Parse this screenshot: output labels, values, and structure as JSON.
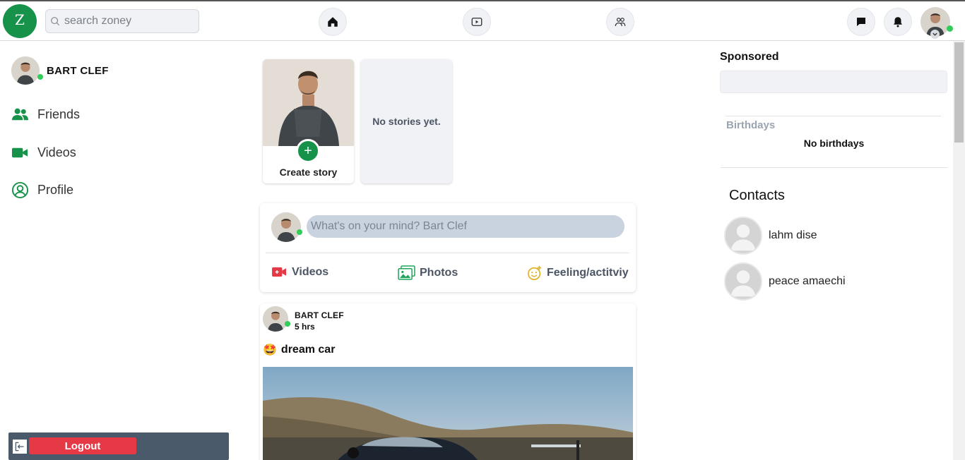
{
  "header": {
    "logo_letter": "Z",
    "search_placeholder": "search zoney",
    "nav": [
      "home-icon",
      "video-icon",
      "groups-icon"
    ],
    "actions": [
      "messenger-icon",
      "bell-icon"
    ]
  },
  "sidebar": {
    "user_name": "BART CLEF",
    "items": [
      {
        "label": "Friends",
        "icon": "friends-icon"
      },
      {
        "label": "Videos",
        "icon": "video-camera-icon"
      },
      {
        "label": "Profile",
        "icon": "profile-icon"
      }
    ],
    "logout_label": "Logout"
  },
  "stories": {
    "create_label": "Create story",
    "empty_label": "No stories yet."
  },
  "composer": {
    "placeholder": "What's on your mind? Bart Clef",
    "actions": [
      {
        "label": "Videos",
        "icon": "live-video-icon",
        "color": "#e63946"
      },
      {
        "label": "Photos",
        "icon": "photos-icon",
        "color": "#22a55b"
      },
      {
        "label": "Feeling/actitviy",
        "icon": "feeling-icon",
        "color": "#e0b020"
      }
    ]
  },
  "post": {
    "author": "BART CLEF",
    "time": "5 hrs",
    "emoji": "🤩",
    "text": "dream car"
  },
  "right": {
    "sponsored_title": "Sponsored",
    "birthdays_title": "Birthdays",
    "birthdays_empty": "No birthdays",
    "contacts_title": "Contacts",
    "contacts": [
      "lahm dise",
      "peace amaechi"
    ]
  },
  "colors": {
    "brand": "#17924a",
    "online": "#31cc5a",
    "logout": "#e63946"
  }
}
